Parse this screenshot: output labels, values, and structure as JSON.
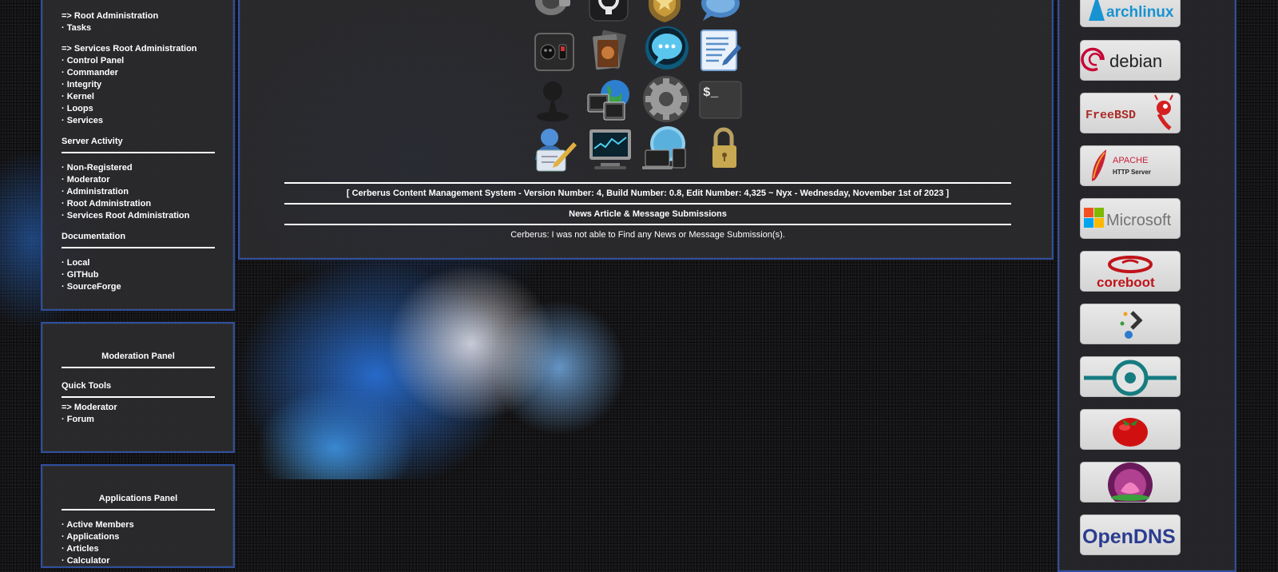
{
  "sidebar": {
    "group_root": {
      "title": "=> Root Administration",
      "items": [
        "Tasks"
      ]
    },
    "group_services": {
      "title": "=> Services Root Administration",
      "items": [
        "Control Panel",
        "Commander",
        "Integrity",
        "Kernel",
        "Loops",
        "Services"
      ]
    },
    "server_activity": {
      "heading": "Server Activity",
      "items": [
        "Non-Registered",
        "Moderator",
        "Administration",
        "Root Administration",
        "Services Root Administration"
      ]
    },
    "documentation": {
      "heading": "Documentation",
      "items": [
        "Local",
        "GITHub",
        "SourceForge"
      ]
    }
  },
  "moderation_panel": {
    "title": "Moderation Panel",
    "quick_tools": "Quick Tools",
    "moderator_link": "=> Moderator",
    "items": [
      "Forum"
    ]
  },
  "applications_panel": {
    "title": "Applications Panel",
    "items": [
      "Active Members",
      "Applications",
      "Articles",
      "Calculator"
    ]
  },
  "center": {
    "icons": [
      [
        "speaker-icon",
        "github-icon",
        "badge-icon",
        "chat-bird-icon"
      ],
      [
        "power-panel-icon",
        "photos-icon",
        "chat-bubble-icon",
        "text-edit-icon"
      ],
      [
        "user-silhouette-icon",
        "network-globe-icon",
        "settings-gear-icon",
        "terminal-icon"
      ],
      [
        "user-edit-icon",
        "monitor-icon",
        "devices-globe-icon",
        "lock-icon"
      ]
    ],
    "terminal_glyph": "$_",
    "version_line": "[ Cerberus Content Management System - Version Number: 4, Build Number: 0.8, Edit Number: 4,325 ~ Nyx - Wednesday, November 1st of 2023 ]",
    "news_heading": "News Article & Message Submissions",
    "news_message": "Cerberus: I was not able to Find any News or Message Submission(s)."
  },
  "technology_icons": [
    {
      "name": "archlinux-icon",
      "text": "archlinux",
      "color": "#1793d1"
    },
    {
      "name": "debian-icon",
      "text": "debian",
      "color": "#222222"
    },
    {
      "name": "freebsd-icon",
      "text": "FreeBSD",
      "color": "#ab2b28"
    },
    {
      "name": "apache-icon",
      "text": "APACHE",
      "subtext": "HTTP Server",
      "color": "#c92037"
    },
    {
      "name": "microsoft-icon",
      "text": "Microsoft",
      "color": "#737373"
    },
    {
      "name": "coreboot-icon",
      "text": "coreboot",
      "color": "#c0141b"
    },
    {
      "name": "prompt-icon",
      "text": "",
      "color": "#333333"
    },
    {
      "name": "lineageos-icon",
      "text": "",
      "color": "#167c80"
    },
    {
      "name": "tomato-icon",
      "text": "",
      "color": "#d01010"
    },
    {
      "name": "lotus-icon",
      "text": "",
      "color": "#b04090"
    },
    {
      "name": "opendns-icon",
      "text": "OpenDNS",
      "color": "#2b3c8f"
    }
  ]
}
